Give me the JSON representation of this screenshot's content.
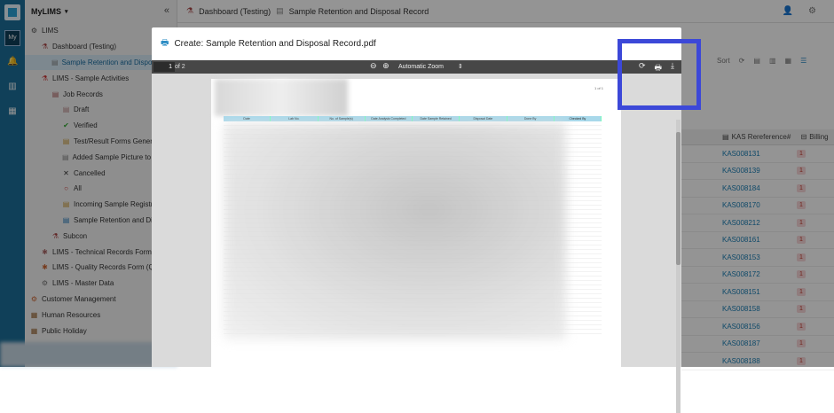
{
  "app": {
    "name": "MyLIMS",
    "rail_label": "My"
  },
  "breadcrumb": {
    "root": "Dashboard (Testing)",
    "current": "Sample Retention and Disposal Record"
  },
  "sidebar": {
    "items": [
      {
        "label": "LIMS",
        "level": 0
      },
      {
        "label": "Dashboard (Testing)",
        "level": 1
      },
      {
        "label": "Sample Retention and Disposal Record",
        "level": 2,
        "selected": true
      },
      {
        "label": "LIMS - Sample Activities",
        "level": 1
      },
      {
        "label": "Job Records",
        "level": 2
      },
      {
        "label": "Draft",
        "level": 3
      },
      {
        "label": "Verified",
        "level": 3
      },
      {
        "label": "Test/Result Forms Generated",
        "level": 3
      },
      {
        "label": "Added Sample Picture to Records",
        "level": 3
      },
      {
        "label": "Cancelled",
        "level": 3
      },
      {
        "label": "All",
        "level": 3
      },
      {
        "label": "Incoming Sample Registration",
        "level": 3
      },
      {
        "label": "Sample Retention and Disposal",
        "level": 3
      },
      {
        "label": "Subcon",
        "level": 2
      },
      {
        "label": "LIMS - Technical Records Form (TRF)",
        "level": 1
      },
      {
        "label": "LIMS - Quality Records Form (QRF)",
        "level": 1
      },
      {
        "label": "LIMS - Master Data",
        "level": 1
      },
      {
        "label": "Customer Management",
        "level": 0
      },
      {
        "label": "Human Resources",
        "level": 0
      },
      {
        "label": "Public Holiday",
        "level": 0
      }
    ]
  },
  "right": {
    "sort_label": "Sort",
    "col_ref": "KAS Rereference#",
    "col_billing": "Billing",
    "rows": [
      {
        "ref": "KAS008131",
        "badge": "1"
      },
      {
        "ref": "KAS008139",
        "badge": "1"
      },
      {
        "ref": "KAS008184",
        "badge": "1"
      },
      {
        "ref": "KAS008170",
        "badge": "1"
      },
      {
        "ref": "KAS008212",
        "badge": "1"
      },
      {
        "ref": "KAS008161",
        "badge": "1"
      },
      {
        "ref": "KAS008153",
        "badge": "1"
      },
      {
        "ref": "KAS008172",
        "badge": "1"
      },
      {
        "ref": "KAS008151",
        "badge": "1"
      },
      {
        "ref": "KAS008158",
        "badge": "1"
      },
      {
        "ref": "KAS008156",
        "badge": "1"
      },
      {
        "ref": "KAS008187",
        "badge": "1"
      },
      {
        "ref": "KAS008188",
        "badge": "1"
      }
    ]
  },
  "dialog": {
    "title": "Create: Sample Retention and Disposal Record.pdf",
    "page_number": "1",
    "page_total": "of 2",
    "zoom": "Automatic Zoom",
    "page_of_label": "1 of 1",
    "table_headers": [
      "Date",
      "Lab No.",
      "No. of Sample(s)",
      "Date Analysis Completed",
      "Date Sample Retained",
      "Disposal Date",
      "Done By",
      "Checked By"
    ]
  },
  "colors": {
    "rail": "#1d6f9a",
    "highlight": "#3c48d8",
    "link": "#1a7fb5"
  }
}
